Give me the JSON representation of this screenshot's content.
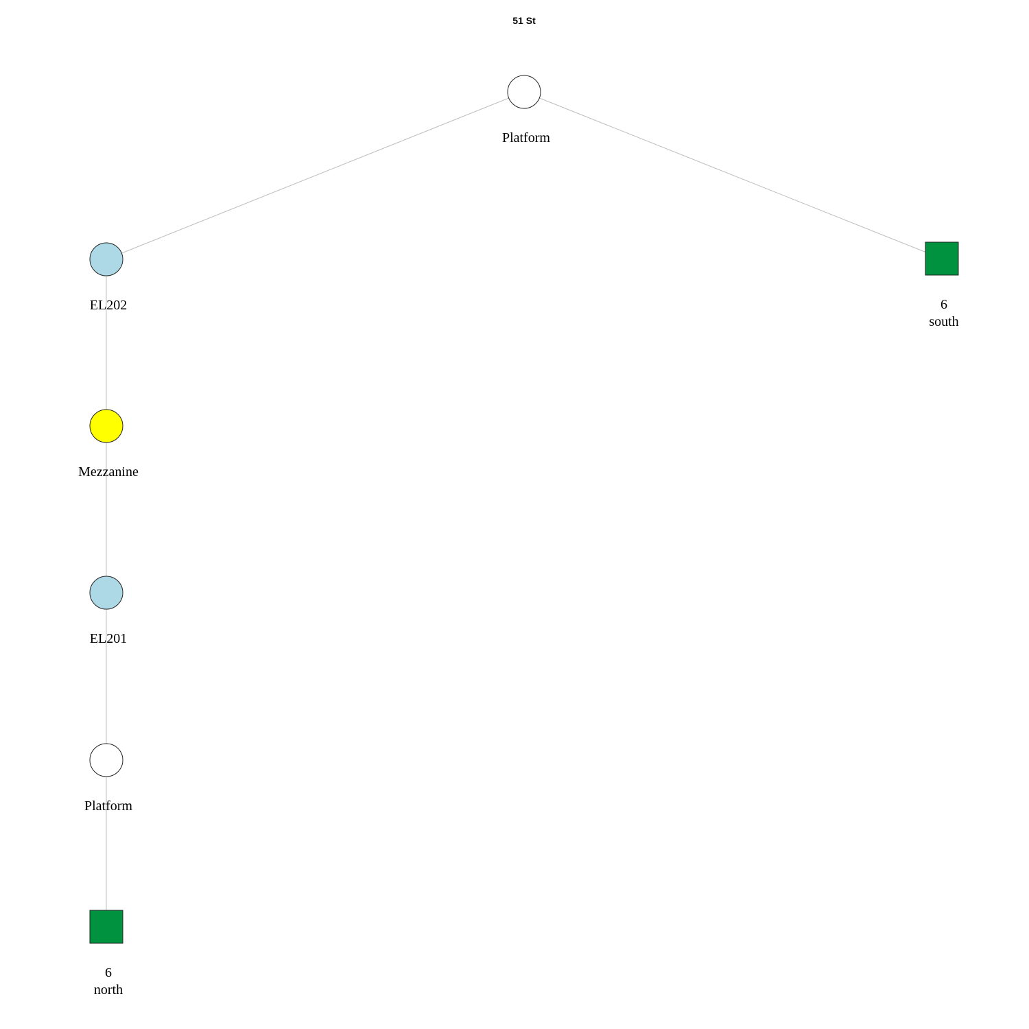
{
  "title": "51 St",
  "colors": {
    "edge": "#bdbdbd",
    "stroke": "#222222",
    "elevator": "#add8e6",
    "mezzanine": "#ffff00",
    "platform": "#ffffff",
    "street": "#00923f"
  },
  "nodes": [
    {
      "id": "platform-top",
      "shape": "circle",
      "fill": "platform",
      "label": [
        "Platform"
      ]
    },
    {
      "id": "el202",
      "shape": "circle",
      "fill": "elevator",
      "label": [
        "EL202"
      ]
    },
    {
      "id": "south-6",
      "shape": "square",
      "fill": "street",
      "label": [
        "6",
        "south"
      ]
    },
    {
      "id": "mezzanine",
      "shape": "circle",
      "fill": "mezzanine",
      "label": [
        "Mezzanine"
      ]
    },
    {
      "id": "el201",
      "shape": "circle",
      "fill": "elevator",
      "label": [
        "EL201"
      ]
    },
    {
      "id": "platform-bottom",
      "shape": "circle",
      "fill": "platform",
      "label": [
        "Platform"
      ]
    },
    {
      "id": "north-6",
      "shape": "square",
      "fill": "street",
      "label": [
        "6",
        "north"
      ]
    }
  ],
  "edges": [
    [
      "platform-top",
      "el202"
    ],
    [
      "platform-top",
      "south-6"
    ],
    [
      "el202",
      "mezzanine"
    ],
    [
      "mezzanine",
      "el201"
    ],
    [
      "el201",
      "platform-bottom"
    ],
    [
      "platform-bottom",
      "north-6"
    ]
  ]
}
